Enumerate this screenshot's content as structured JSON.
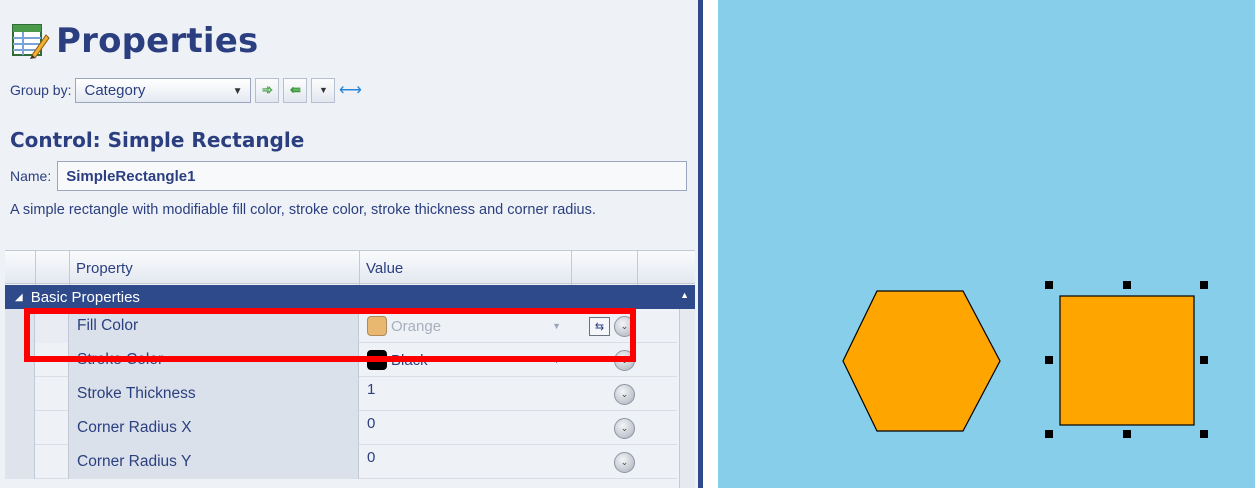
{
  "panel": {
    "title": "Properties",
    "title_icon": "properties-grid-icon",
    "group_by_label": "Group by:",
    "group_by_value": "Category",
    "toolbar": {
      "expand_icon": "expand-all-icon",
      "collapse_icon": "collapse-all-icon",
      "menu_icon": "dropdown-menu-icon",
      "resize_icon": "horizontal-resize-icon"
    },
    "control_title": "Control: Simple Rectangle",
    "name_label": "Name:",
    "name_value": "SimpleRectangle1",
    "description": "A simple rectangle with modifiable fill color, stroke color, stroke thickness and corner radius."
  },
  "grid": {
    "columns": [
      "Property",
      "Value"
    ],
    "category": "Basic Properties",
    "rows": [
      {
        "name": "Fill Color",
        "value": "Orange",
        "swatch": "#e8b870"
      },
      {
        "name": "Stroke Color",
        "value": "Black",
        "swatch": "#000000"
      },
      {
        "name": "Stroke Thickness",
        "value": "1"
      },
      {
        "name": "Corner Radius X",
        "value": "0"
      },
      {
        "name": "Corner Radius Y",
        "value": "0"
      }
    ]
  },
  "colors": {
    "accent": "#2f4a8a",
    "canvas_bg": "#87ceea",
    "shape_fill": "#ffa500",
    "highlight": "#ff0000"
  }
}
